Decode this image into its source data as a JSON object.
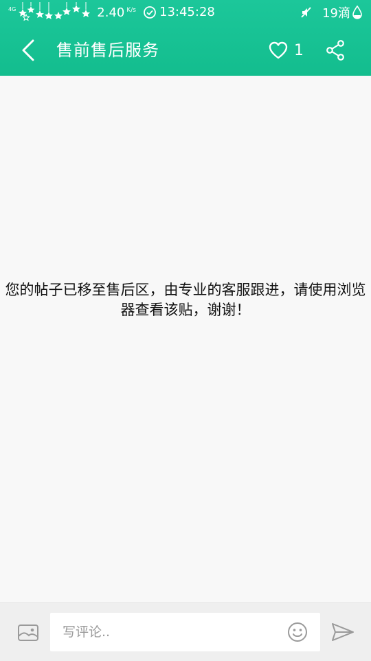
{
  "status_bar": {
    "network_type": "4G",
    "net_speed": "2.40",
    "net_speed_unit": "K/s",
    "time": "13:45:28",
    "battery_text": "19滴"
  },
  "toolbar": {
    "title": "售前售后服务",
    "like_count": "1"
  },
  "content": {
    "notice": "您的帖子已移至售后区，由专业的客服跟进，请使用浏览器查看该贴，谢谢！"
  },
  "comment_bar": {
    "placeholder": "写评论.."
  },
  "colors": {
    "appbar": "#17c394",
    "page_background": "#f8f8f8",
    "bottom_bar": "#efefef",
    "icon_gray": "#9a9a9a"
  }
}
